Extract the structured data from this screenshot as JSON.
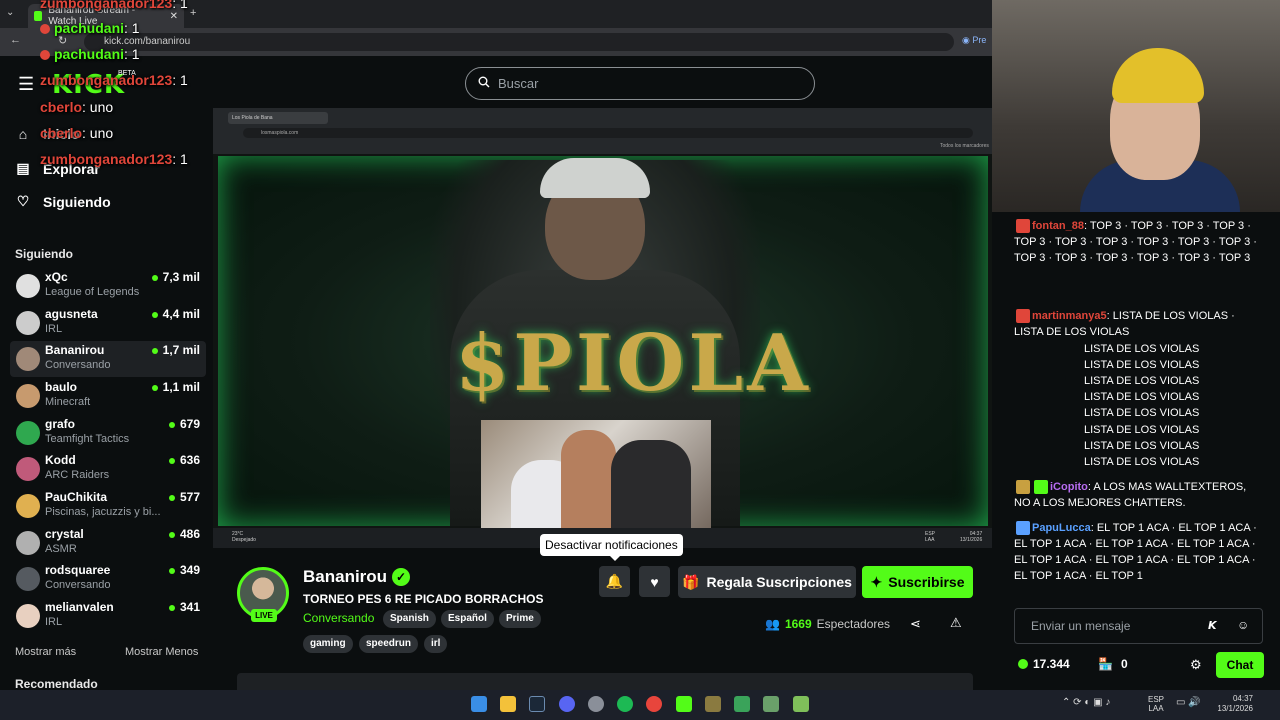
{
  "browser": {
    "tab_title": "Bananirou Stream - Watch Live",
    "url": "kick.com/bananirou",
    "right_label": "Pre"
  },
  "header": {
    "logo": "KICK",
    "beta": "BETA",
    "search_placeholder": "Buscar"
  },
  "overlay_chat": [
    {
      "user": "zumbonganador123",
      "msg": ": 1",
      "color": "#e0463a",
      "dot": false
    },
    {
      "user": "pachudani",
      "msg": ": 1",
      "color": "#53fc18",
      "dot": true
    },
    {
      "user": "pachudani",
      "msg": ": 1",
      "color": "#53fc18",
      "dot": true
    },
    {
      "user": "zumbonganador123",
      "msg": ": 1",
      "color": "#e0463a",
      "dot": false
    },
    {
      "user": "cberlo",
      "msg": ": uno",
      "color": "#e0463a",
      "dot": false
    },
    {
      "user": "cberlo",
      "msg": ": uno",
      "color": "#e0463a",
      "dot": false
    },
    {
      "user": "zumbonganador123",
      "msg": ": 1",
      "color": "#e0463a",
      "dot": false
    }
  ],
  "sidebar": {
    "nav": [
      {
        "label": "Inicio",
        "icon": "home-icon"
      },
      {
        "label": "Explorar",
        "icon": "browse-icon"
      },
      {
        "label": "Siguiendo",
        "icon": "heart-icon"
      }
    ],
    "following_title": "Siguiendo",
    "following": [
      {
        "name": "xQc",
        "category": "League of Legends",
        "viewers": "7,3 mil",
        "color": "#e0e0e0"
      },
      {
        "name": "agusneta",
        "category": "IRL",
        "viewers": "4,4 mil",
        "color": "#cccccc"
      },
      {
        "name": "Bananirou",
        "category": "Conversando",
        "viewers": "1,7 mil",
        "color": "#a08978"
      },
      {
        "name": "baulo",
        "category": "Minecraft",
        "viewers": "1,1 mil",
        "color": "#c79a6e"
      },
      {
        "name": "grafo",
        "category": "Teamfight Tactics",
        "viewers": "679",
        "color": "#2fa84f"
      },
      {
        "name": "Kodd",
        "category": "ARC Raiders",
        "viewers": "636",
        "color": "#c05a7a"
      },
      {
        "name": "PauChikita",
        "category": "Piscinas, jacuzzis y bi...",
        "viewers": "577",
        "color": "#e0b050"
      },
      {
        "name": "crystal",
        "category": "ASMR",
        "viewers": "486",
        "color": "#b0b0b0"
      },
      {
        "name": "rodsquaree",
        "category": "Conversando",
        "viewers": "349",
        "color": "#555a60"
      },
      {
        "name": "melianvalen",
        "category": "IRL",
        "viewers": "341",
        "color": "#e8d0c0"
      }
    ],
    "show_more": "Mostrar más",
    "show_less": "Mostrar Menos",
    "recommended": "Recomendado"
  },
  "video": {
    "inner_tab": "Los Piola de Bana",
    "inner_url": "losmaspiola.com",
    "inner_meta": "Todos los marcadores",
    "brand": "$PIOLA",
    "weather": "23°C",
    "weather_desc": "Despejado",
    "inner_lang": "ESP",
    "inner_lang2": "LAA",
    "inner_time": "04:37",
    "inner_date": "13/1/2026"
  },
  "stream": {
    "channel": "Bananirou",
    "live": "LIVE",
    "title": "TORNEO PES 6 RE PICADO BORRACHOS",
    "category": "Conversando",
    "tags_row1": [
      "Spanish",
      "Español",
      "Prime"
    ],
    "tags_row2": [
      "gaming",
      "speedrun",
      "irl"
    ],
    "tooltip": "Desactivar notificaciones",
    "gift_label": "Regala Suscripciones",
    "subscribe_label": "Suscribirse",
    "viewers_count": "1669",
    "viewers_label": "Espectadores"
  },
  "chat": {
    "messages": [
      {
        "user": "fontan_88",
        "color": "#e0463a",
        "text": "TOP 3 · TOP 3 · TOP 3 · TOP 3 · TOP 3 · TOP 3 · TOP 3 · TOP 3 · TOP 3 · TOP 3 · TOP 3 · TOP 3 · TOP 3 · TOP 3 · TOP 3 · TOP 3"
      },
      {
        "user": "martinmanya5",
        "color": "#e0463a",
        "text": "LISTA DE LOS VIOLAS · LISTA DE LOS VIOLAS"
      },
      {
        "user": "",
        "color": "#ffffff",
        "text": "LISTA DE LOS VIOLAS"
      },
      {
        "user": "",
        "color": "#ffffff",
        "text": "LISTA DE LOS VIOLAS"
      },
      {
        "user": "",
        "color": "#ffffff",
        "text": "LISTA DE LOS VIOLAS"
      },
      {
        "user": "",
        "color": "#ffffff",
        "text": "LISTA DE LOS VIOLAS"
      },
      {
        "user": "",
        "color": "#ffffff",
        "text": "LISTA DE LOS VIOLAS"
      },
      {
        "user": "",
        "color": "#ffffff",
        "text": "LISTA DE LOS VIOLAS"
      },
      {
        "user": "",
        "color": "#ffffff",
        "text": "LISTA DE LOS VIOLAS"
      },
      {
        "user": "",
        "color": "#ffffff",
        "text": "LISTA DE LOS VIOLAS"
      },
      {
        "user": "iCopito",
        "color": "#b76cf0",
        "text": "A LOS MAS WALLTEXTEROS, NO A LOS MEJORES CHATTERS."
      },
      {
        "user": "PapuLucca",
        "color": "#5aa0ff",
        "text": "EL TOP 1 ACA · EL TOP 1 ACA · EL TOP 1 ACA · EL TOP 1 ACA · EL TOP 1 ACA · EL TOP 1 ACA · EL TOP 1 ACA · EL TOP 1 ACA · EL TOP 1 ACA · EL TOP 1"
      }
    ],
    "input_placeholder": "Enviar un mensaje",
    "points": "17.344",
    "store_count": "0",
    "send_label": "Chat"
  },
  "taskbar": {
    "lang": "ESP",
    "lang2": "LAA",
    "time": "04:37",
    "date": "13/1/2026"
  },
  "colors": {
    "accent": "#53fc18",
    "background": "#0b0e0f"
  }
}
